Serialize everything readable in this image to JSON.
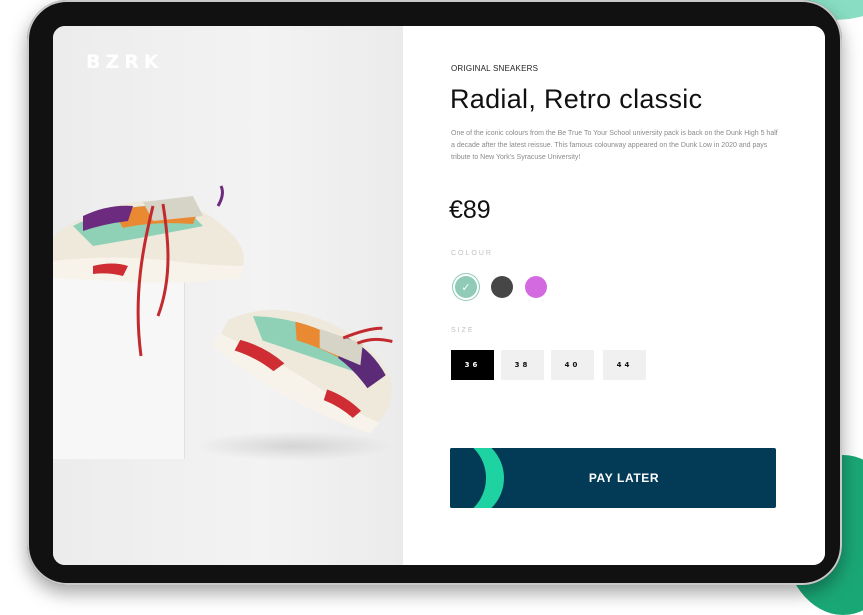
{
  "brand": {
    "logo_text": "BZRK"
  },
  "product": {
    "category": "ORIGINAL SNEAKERS",
    "title": "Radial, Retro classic",
    "description": "One of the iconic colours from the Be True To Your School university pack is back on the Dunk High 5 half a decade after the latest reissue. This famous colourway appeared on the Dunk Low in 2020 and pays tribute to New York's Syracuse University!",
    "price": "€89"
  },
  "colour": {
    "label": "COLOUR",
    "options": [
      {
        "name": "mint",
        "hex": "#8fcbb6",
        "selected": true
      },
      {
        "name": "charcoal",
        "hex": "#464646",
        "selected": false
      },
      {
        "name": "violet",
        "hex": "#d36ae0",
        "selected": false
      }
    ]
  },
  "size": {
    "label": "SIZE",
    "options": [
      "36",
      "38",
      "40",
      "44"
    ],
    "selected": "36"
  },
  "cta": {
    "label": "PAY LATER"
  },
  "colors": {
    "accent": "#1ed3a1",
    "cta_bg": "#033b57"
  }
}
